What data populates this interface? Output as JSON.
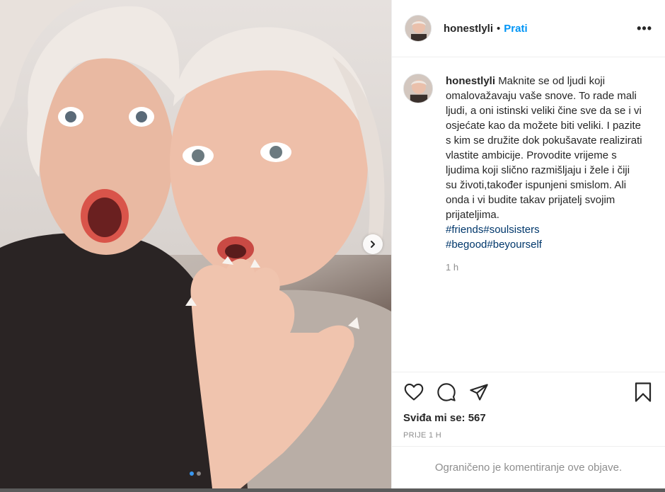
{
  "post": {
    "username": "honestlyli",
    "separator": "•",
    "follow_label": "Prati",
    "more_icon": "more-options-icon",
    "more_label": "•••",
    "caption_username": "honestlyli",
    "caption_text": "Maknite se od ljudi koji omalovažavaju vaše snove. To rade mali ljudi, a oni istinski veliki čine sve da se i vi osjećate kao da možete biti veliki. I pazite s kim se družite dok pokušavate realizirati vlastite ambicije. Provodite vrijeme s ljudima koji slično razmišljaju i žele i čiji su životi,također ispunjeni smislom. Ali onda i vi budite takav prijatelj svojim prijateljima.",
    "hashtags_line1": [
      "#friends",
      "#soulsisters"
    ],
    "hashtags_line2": [
      "#begood",
      "#beyourself"
    ],
    "caption_time": "1 h",
    "likes": "Sviđa mi se: 567",
    "posted_ago": "PRIJE 1 H",
    "comments_disabled": "Ograničeno je komentiranje ove objave."
  },
  "carousel": {
    "active_index": 1,
    "total": 2,
    "active_color": "#3897f0"
  },
  "colors": {
    "follow": "#0095f6",
    "hashtag": "#00376b",
    "muted": "#8e8e8e"
  }
}
